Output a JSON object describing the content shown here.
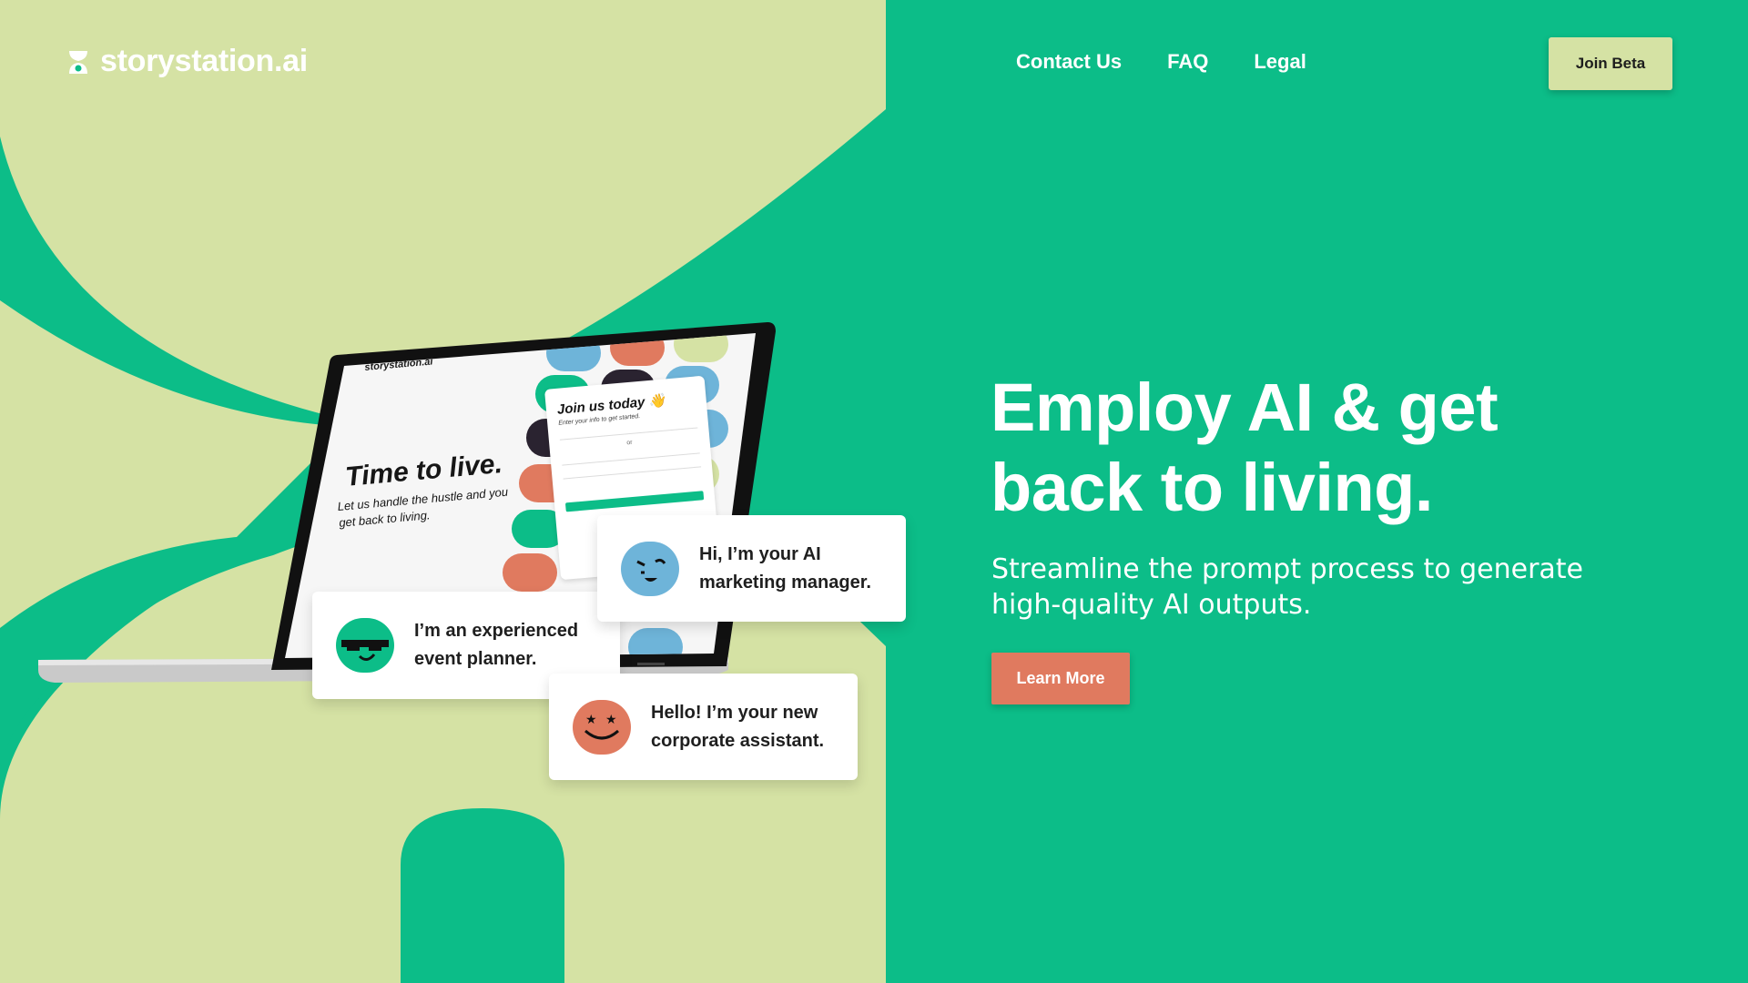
{
  "brand": {
    "name": "storystation.ai",
    "primary_color": "#0cbd88",
    "light_color": "#d5e2a4",
    "accent_color": "#e07a5f"
  },
  "nav": {
    "items": [
      {
        "label": "Contact Us"
      },
      {
        "label": "FAQ"
      },
      {
        "label": "Legal"
      }
    ]
  },
  "header": {
    "cta_label": "Join Beta"
  },
  "hero": {
    "title": "Employ AI & get back to living.",
    "subtitle": "Streamline the prompt process to generate high-quality AI outputs.",
    "cta_label": "Learn More"
  },
  "laptop_screen": {
    "brand": "storystation.ai",
    "title": "Time to live.",
    "tagline": "Let us handle the hustle and you get back to living.",
    "form_title": "Join us today 👋",
    "form_subtitle": "Enter your info to get started.",
    "form_or": "or"
  },
  "cards": [
    {
      "text": "Hi, I’m your AI marketing manager.",
      "avatar_icon": "blue-winking-face-icon"
    },
    {
      "text": "I’m an experienced event planner.",
      "avatar_icon": "green-sunglasses-face-icon"
    },
    {
      "text": "Hello! I’m your new corporate assistant.",
      "avatar_icon": "orange-star-eyes-face-icon"
    }
  ]
}
